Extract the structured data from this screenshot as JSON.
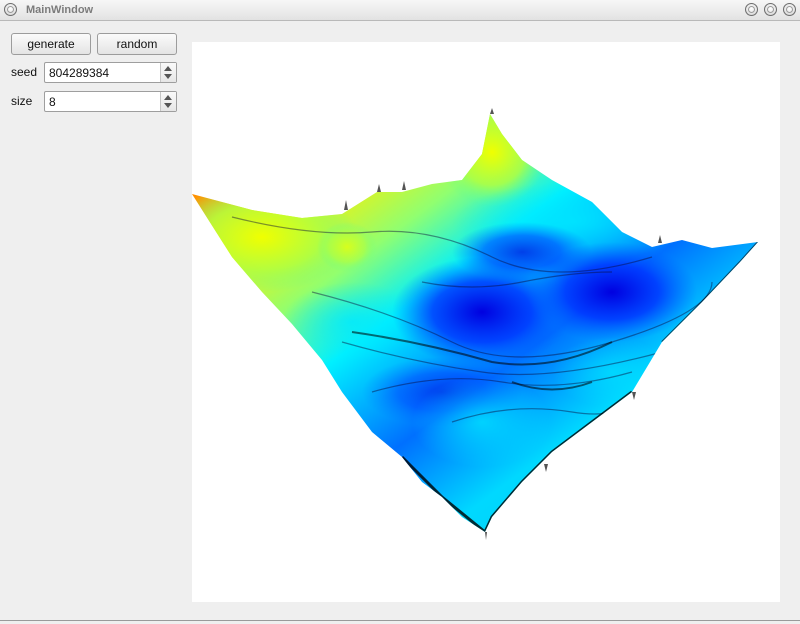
{
  "window": {
    "title": "MainWindow"
  },
  "controls": {
    "generate_label": "generate",
    "random_label": "random",
    "seed_label": "seed",
    "seed_value": "804289384",
    "size_label": "size",
    "size_value": "8"
  },
  "viewport": {
    "content": "3D fractal terrain heightmap",
    "colormap": [
      "#00006a",
      "#0000ff",
      "#0080ff",
      "#00e5ff",
      "#80ff80",
      "#ffff00",
      "#ff8000",
      "#e82000"
    ]
  }
}
